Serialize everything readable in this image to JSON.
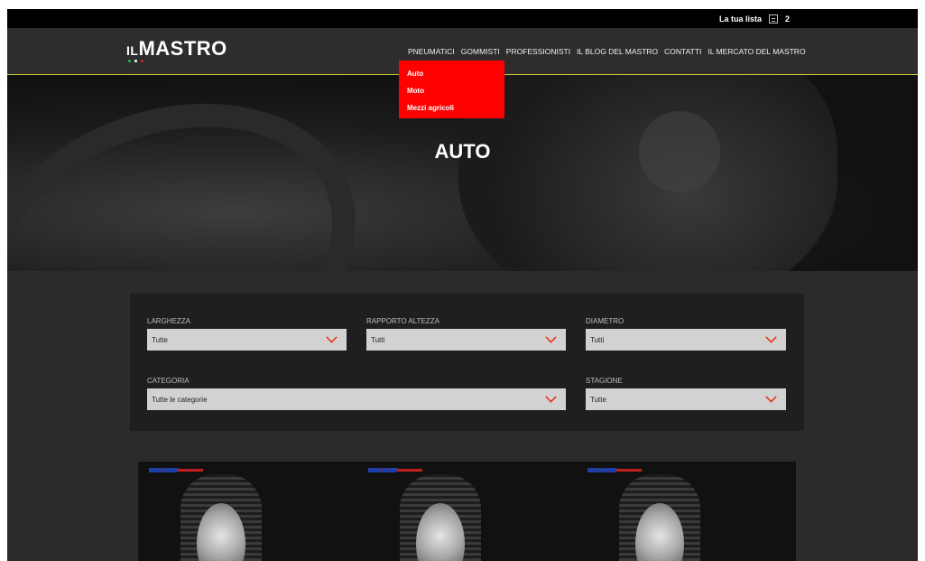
{
  "wishlist": {
    "label": "La tua lista",
    "count": "2"
  },
  "logo": {
    "prefix": "IL",
    "name": "MASTRO",
    "dot_colors": [
      "#2fb04a",
      "#ffffff",
      "#e21b1b"
    ]
  },
  "nav": {
    "items": [
      "PNEUMATICI",
      "GOMMISTI",
      "PROFESSIONISTI",
      "IL BLOG DEL MASTRO",
      "CONTATTI",
      "IL MERCATO DEL MASTRO"
    ],
    "dropdown": [
      "Auto",
      "Moto",
      "Mezzi agricoli"
    ]
  },
  "hero": {
    "title": "AUTO"
  },
  "filters": {
    "larghezza": {
      "label": "LARGHEZZA",
      "value": "Tutte"
    },
    "rapporto": {
      "label": "RAPPORTO ALTEZZA",
      "value": "Tutti"
    },
    "diametro": {
      "label": "DIAMETRO",
      "value": "Tutti"
    },
    "categoria": {
      "label": "CATEGORIA",
      "value": "Tutte le categorie"
    },
    "stagione": {
      "label": "STAGIONE",
      "value": "Tutte"
    }
  },
  "colors": {
    "accent": "#ff0000",
    "chevron": "#e8341c",
    "header_line": "#c8c43a"
  }
}
